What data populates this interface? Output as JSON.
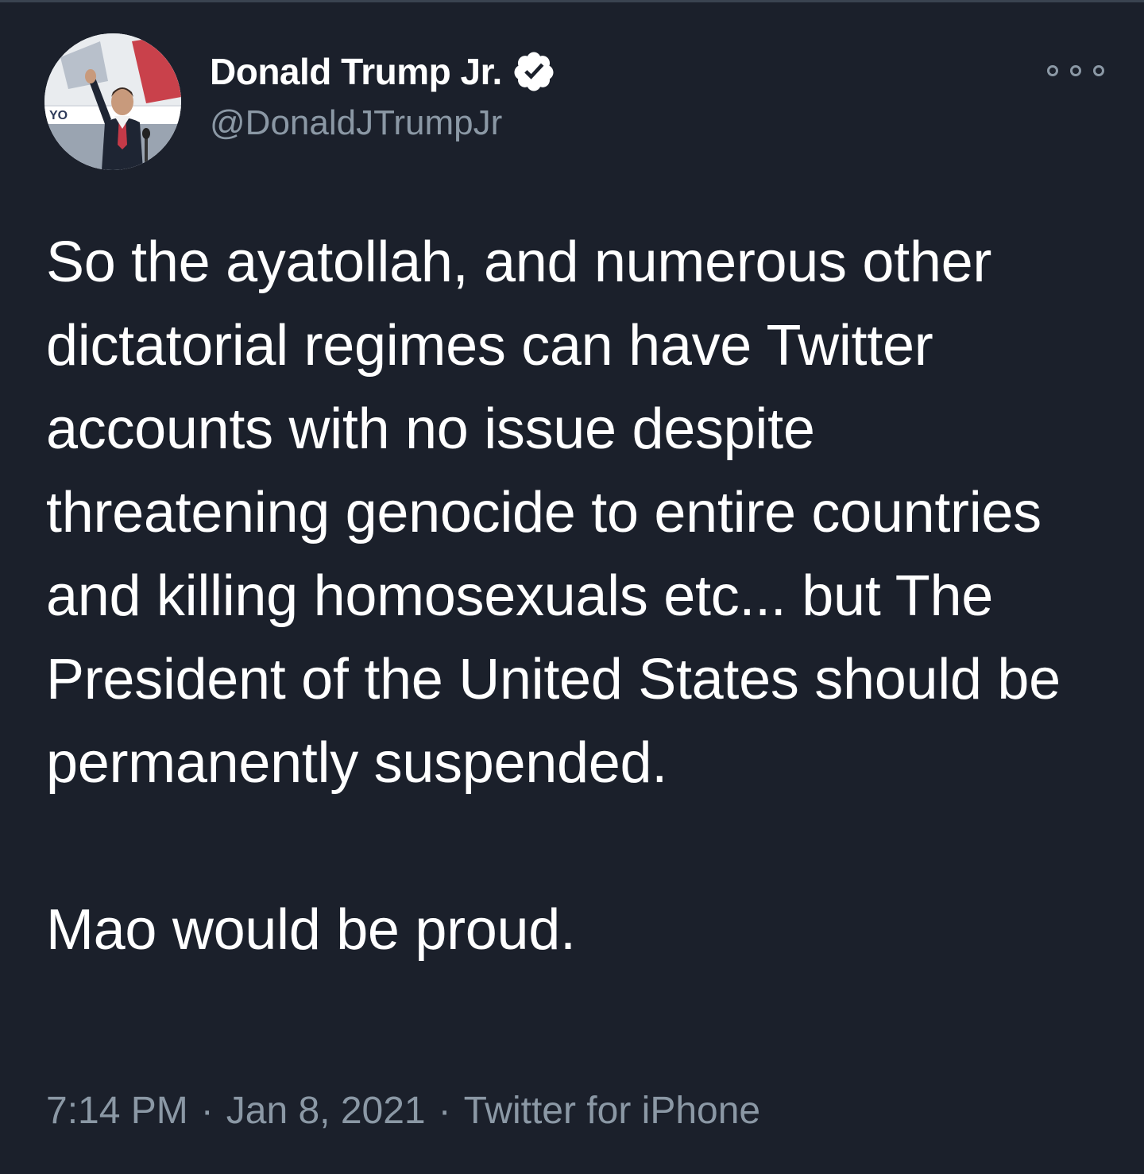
{
  "tweet": {
    "author": {
      "display_name": "Donald Trump Jr.",
      "handle": "@DonaldJTrumpJr",
      "verified": true,
      "avatar_icon": "profile-photo"
    },
    "more_icon": "more-options-icon",
    "text": "So the ayatollah, and numerous other dictatorial regimes can have Twitter accounts with no issue despite threatening genocide to entire countries and killing homosexuals etc... but The President of the United States should be permanently suspended.\n\nMao would be proud.",
    "time": "7:14 PM",
    "date": "Jan 8, 2021",
    "separator": "·",
    "source": "Twitter for iPhone"
  },
  "colors": {
    "background": "#1b202b",
    "text_primary": "#ffffff",
    "text_secondary": "#8b98a5",
    "verified_badge": "#ffffff"
  }
}
